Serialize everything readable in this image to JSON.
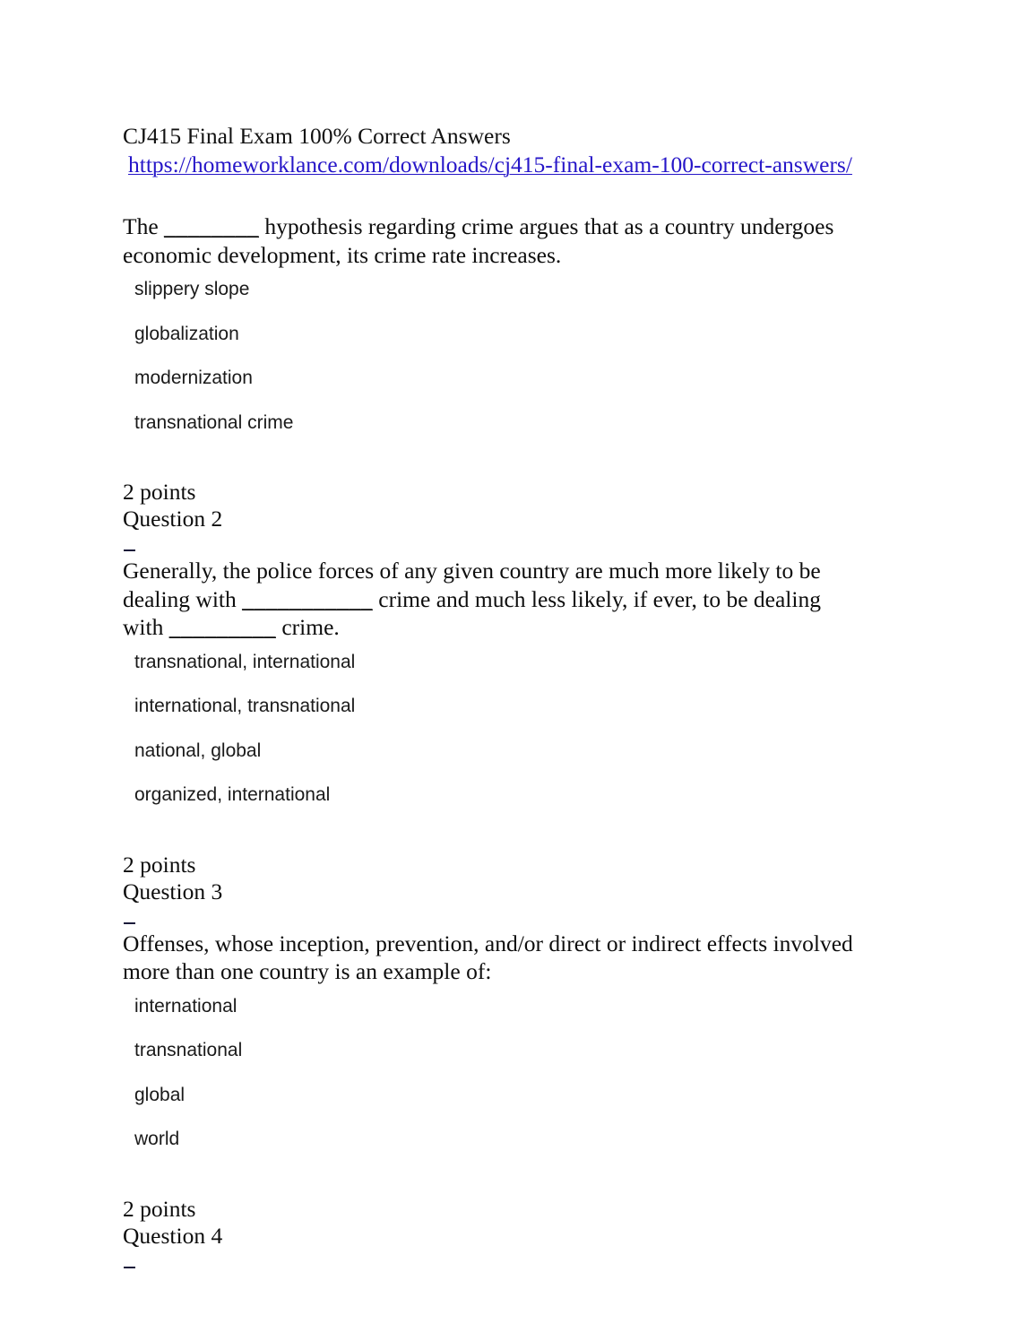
{
  "document": {
    "title": "CJ415 Final Exam 100% Correct Answers",
    "link_text": "https://homeworklance.com/downloads/cj415-final-exam-100-correct-answers/",
    "link_color": "#2616c8",
    "background_color": "#ffffff",
    "text_color": "#0d0d0d"
  },
  "questions": [
    {
      "stem_part1": "The ",
      "blank1": "________",
      "stem_part2": " hypothesis regarding crime argues that as a country undergoes economic development, its crime rate increases.",
      "options": [
        "slippery slope",
        "globalization",
        "modernization",
        "transnational crime"
      ],
      "points_label": "2 points",
      "next_question_label": "Question 2"
    },
    {
      "stem_part1": "Generally, the police forces of any given country are much more likely to be dealing with ",
      "blank1": "___________",
      "stem_part2": " crime and much less likely, if ever, to be dealing with ",
      "blank2": "_________",
      "stem_part3": " crime.",
      "options": [
        "transnational, international",
        "international, transnational",
        "national, global",
        "organized, international"
      ],
      "points_label": "2 points",
      "next_question_label": "Question 3"
    },
    {
      "stem_part1": "Offenses, whose inception, prevention, and/or direct or indirect effects involved more than one country is an example of:",
      "options": [
        "international",
        "transnational",
        "global",
        "world"
      ],
      "points_label": "2 points",
      "next_question_label": "Question 4"
    }
  ]
}
